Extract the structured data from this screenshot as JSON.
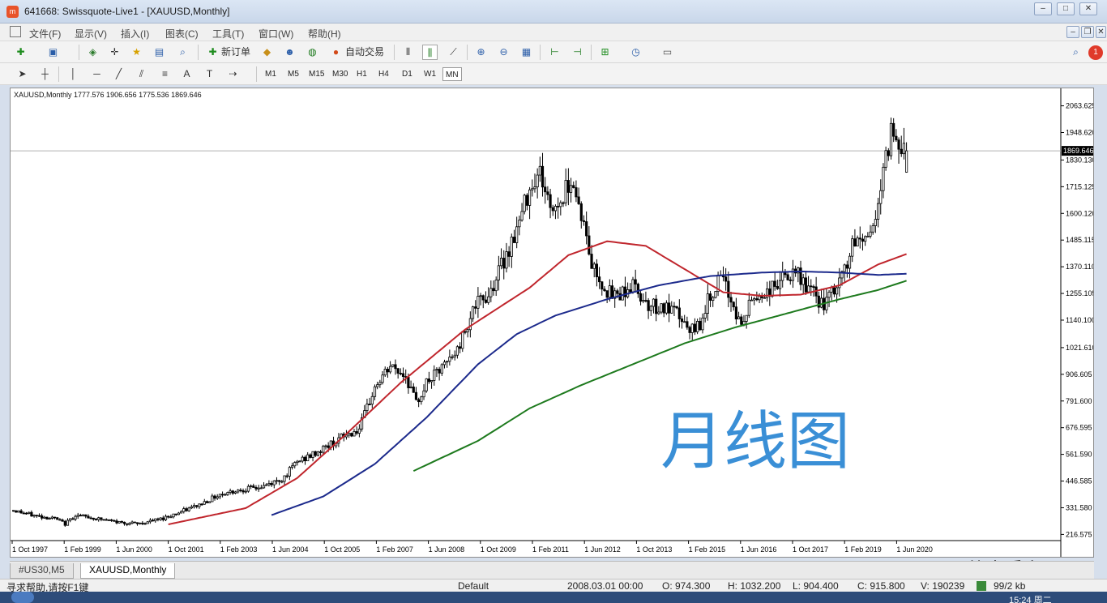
{
  "window": {
    "title": "641668: Swissquote-Live1 - [XAUUSD,Monthly]",
    "app_icon": "m",
    "controls": [
      "–",
      "□",
      "✕"
    ],
    "mdi_controls": [
      "–",
      "❐",
      "✕"
    ]
  },
  "menu": [
    "文件(F)",
    "显示(V)",
    "插入(I)",
    "图表(C)",
    "工具(T)",
    "窗口(W)",
    "帮助(H)"
  ],
  "toolbar": {
    "new_order_label": "新订单",
    "auto_trade_label": "自动交易",
    "notification_count": "1",
    "timeframes": [
      "M1",
      "M5",
      "M15",
      "M30",
      "H1",
      "H4",
      "D1",
      "W1",
      "MN"
    ],
    "active_timeframe": "MN"
  },
  "chart_header": "XAUUSD,Monthly  1777.576 1906.656 1775.536 1869.646",
  "chart_data": {
    "type": "candlestick",
    "symbol": "XAUUSD",
    "timeframe": "Monthly",
    "ohlc_current": {
      "open": 1777.576,
      "high": 1906.656,
      "low": 1775.536,
      "close": 1869.646
    },
    "current_price": 1869.646,
    "ylim": [
      190,
      2125
    ],
    "y_ticks": [
      2063.625,
      1948.62,
      1830.13,
      1715.125,
      1600.12,
      1485.115,
      1370.11,
      1255.105,
      1140.1,
      1021.61,
      906.605,
      791.6,
      676.595,
      561.59,
      446.585,
      331.58,
      216.575
    ],
    "y_tick_labels": [
      "2063.625",
      "1948.620",
      "1830.130",
      "1715.125",
      "1600.120",
      "1485.115",
      "1370.110",
      "1255.105",
      "1140.100",
      "1021.610",
      "906.605",
      "791.600",
      "676.595",
      "561.590",
      "446.585",
      "331.580",
      "216.575"
    ],
    "x_ticks": [
      "1 Oct 1997",
      "1 Feb 1999",
      "1 Jun 2000",
      "1 Oct 2001",
      "1 Feb 2003",
      "1 Jun 2004",
      "1 Oct 2005",
      "1 Feb 2007",
      "1 Jun 2008",
      "1 Oct 2009",
      "1 Feb 2011",
      "1 Jun 2012",
      "1 Oct 2013",
      "1 Feb 2015",
      "1 Jun 2016",
      "1 Oct 2017",
      "1 Feb 2019",
      "1 Jun 2020"
    ],
    "close_anchors": [
      [
        0,
        320
      ],
      [
        8,
        298
      ],
      [
        16,
        285
      ],
      [
        20,
        262
      ],
      [
        24,
        300
      ],
      [
        32,
        285
      ],
      [
        40,
        270
      ],
      [
        48,
        262
      ],
      [
        56,
        280
      ],
      [
        64,
        310
      ],
      [
        72,
        345
      ],
      [
        80,
        390
      ],
      [
        88,
        410
      ],
      [
        96,
        420
      ],
      [
        104,
        455
      ],
      [
        110,
        530
      ],
      [
        116,
        560
      ],
      [
        122,
        600
      ],
      [
        128,
        640
      ],
      [
        134,
        670
      ],
      [
        140,
        850
      ],
      [
        146,
        940
      ],
      [
        152,
        900
      ],
      [
        156,
        780
      ],
      [
        160,
        870
      ],
      [
        166,
        930
      ],
      [
        172,
        1010
      ],
      [
        178,
        1190
      ],
      [
        184,
        1250
      ],
      [
        190,
        1400
      ],
      [
        196,
        1560
      ],
      [
        200,
        1720
      ],
      [
        204,
        1780
      ],
      [
        208,
        1620
      ],
      [
        212,
        1650
      ],
      [
        216,
        1760
      ],
      [
        220,
        1600
      ],
      [
        224,
        1380
      ],
      [
        228,
        1300
      ],
      [
        232,
        1240
      ],
      [
        240,
        1290
      ],
      [
        246,
        1210
      ],
      [
        252,
        1190
      ],
      [
        258,
        1160
      ],
      [
        262,
        1080
      ],
      [
        266,
        1130
      ],
      [
        270,
        1250
      ],
      [
        274,
        1320
      ],
      [
        278,
        1230
      ],
      [
        282,
        1110
      ],
      [
        286,
        1230
      ],
      [
        292,
        1260
      ],
      [
        298,
        1320
      ],
      [
        304,
        1330
      ],
      [
        310,
        1250
      ],
      [
        314,
        1200
      ],
      [
        320,
        1300
      ],
      [
        326,
        1480
      ],
      [
        332,
        1510
      ],
      [
        336,
        1700
      ],
      [
        340,
        1960
      ],
      [
        344,
        1900
      ],
      [
        346,
        1869.646
      ]
    ],
    "overlay_ma": [
      {
        "name": "",
        "color": "#c0262d",
        "start_bar": 60,
        "anchors": [
          [
            60,
            260
          ],
          [
            90,
            330
          ],
          [
            110,
            460
          ],
          [
            130,
            660
          ],
          [
            150,
            870
          ],
          [
            175,
            1100
          ],
          [
            200,
            1280
          ],
          [
            215,
            1420
          ],
          [
            230,
            1480
          ],
          [
            245,
            1460
          ],
          [
            260,
            1360
          ],
          [
            275,
            1260
          ],
          [
            290,
            1245
          ],
          [
            305,
            1250
          ],
          [
            320,
            1290
          ],
          [
            335,
            1380
          ],
          [
            346,
            1425
          ]
        ]
      },
      {
        "name": "",
        "color": "#1c2a8c",
        "start_bar": 100,
        "anchors": [
          [
            100,
            300
          ],
          [
            120,
            380
          ],
          [
            140,
            520
          ],
          [
            160,
            720
          ],
          [
            180,
            950
          ],
          [
            195,
            1080
          ],
          [
            210,
            1160
          ],
          [
            230,
            1230
          ],
          [
            250,
            1290
          ],
          [
            270,
            1330
          ],
          [
            290,
            1345
          ],
          [
            305,
            1350
          ],
          [
            320,
            1345
          ],
          [
            335,
            1335
          ],
          [
            346,
            1340
          ]
        ]
      },
      {
        "name": "",
        "color": "#1e7a1e",
        "start_bar": 155,
        "anchors": [
          [
            155,
            490
          ],
          [
            180,
            620
          ],
          [
            200,
            760
          ],
          [
            220,
            860
          ],
          [
            240,
            950
          ],
          [
            260,
            1040
          ],
          [
            280,
            1110
          ],
          [
            300,
            1170
          ],
          [
            320,
            1230
          ],
          [
            335,
            1270
          ],
          [
            346,
            1310
          ]
        ]
      }
    ]
  },
  "overlay_text": "月线图",
  "tabs": [
    "#US30,M5",
    "XAUUSD,Monthly"
  ],
  "active_tab": "XAUUSD,Monthly",
  "status": {
    "help": "寻求帮助,请按F1键",
    "profile": "Default",
    "datetime": "2008.03.01 00:00",
    "open": "O: 974.300",
    "high": "H: 1032.200",
    "low": "L: 904.400",
    "close": "C: 915.800",
    "volume": "V: 190239",
    "traffic": "99/2 kb"
  },
  "watermark": "@至简享受交易",
  "taskbar": {
    "clock": "15:24 周二"
  }
}
